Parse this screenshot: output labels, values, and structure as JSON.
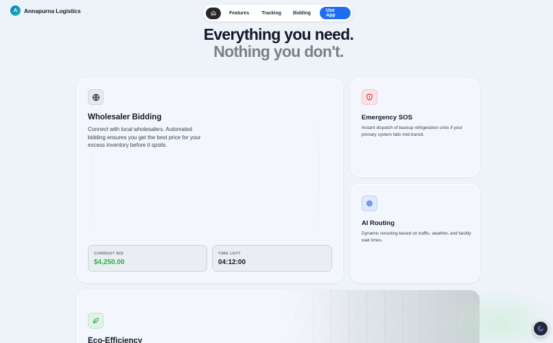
{
  "brand": {
    "logo_letter": "A",
    "name": "Annapurna Logistics"
  },
  "nav": {
    "home_icon": "home-icon",
    "items": [
      {
        "label": "Features"
      },
      {
        "label": "Tracking"
      },
      {
        "label": "Bidding"
      }
    ],
    "cta_label": "Use App",
    "accent": "#1d6ef5"
  },
  "hero": {
    "line1": "Everything you need.",
    "line2": "Nothing you don't."
  },
  "cards": {
    "bidding": {
      "icon": "globe-icon",
      "title": "Wholesaler Bidding",
      "description": "Connect with local wholesalers. Automated bidding ensures you get the best price for your excess inventory before it spoils.",
      "current_bid_label": "CURRENT BID",
      "current_bid_value": "$4,250.00",
      "time_left_label": "TIME LEFT",
      "time_left_value": "04:12:00",
      "bid_color": "#22b24c"
    },
    "sos": {
      "icon": "shield-alert-icon",
      "title": "Emergency SOS",
      "description": "Instant dispatch of backup refrigeration units if your primary system fails mid-transit."
    },
    "ai_routing": {
      "icon": "cpu-chip-icon",
      "title": "AI Routing",
      "description": "Dynamic rerouting based on traffic, weather, and facility wait times."
    },
    "eco": {
      "icon": "leaf-icon",
      "title": "Eco-Efficiency"
    }
  },
  "theme_toggle": {
    "icon": "moon-icon"
  }
}
